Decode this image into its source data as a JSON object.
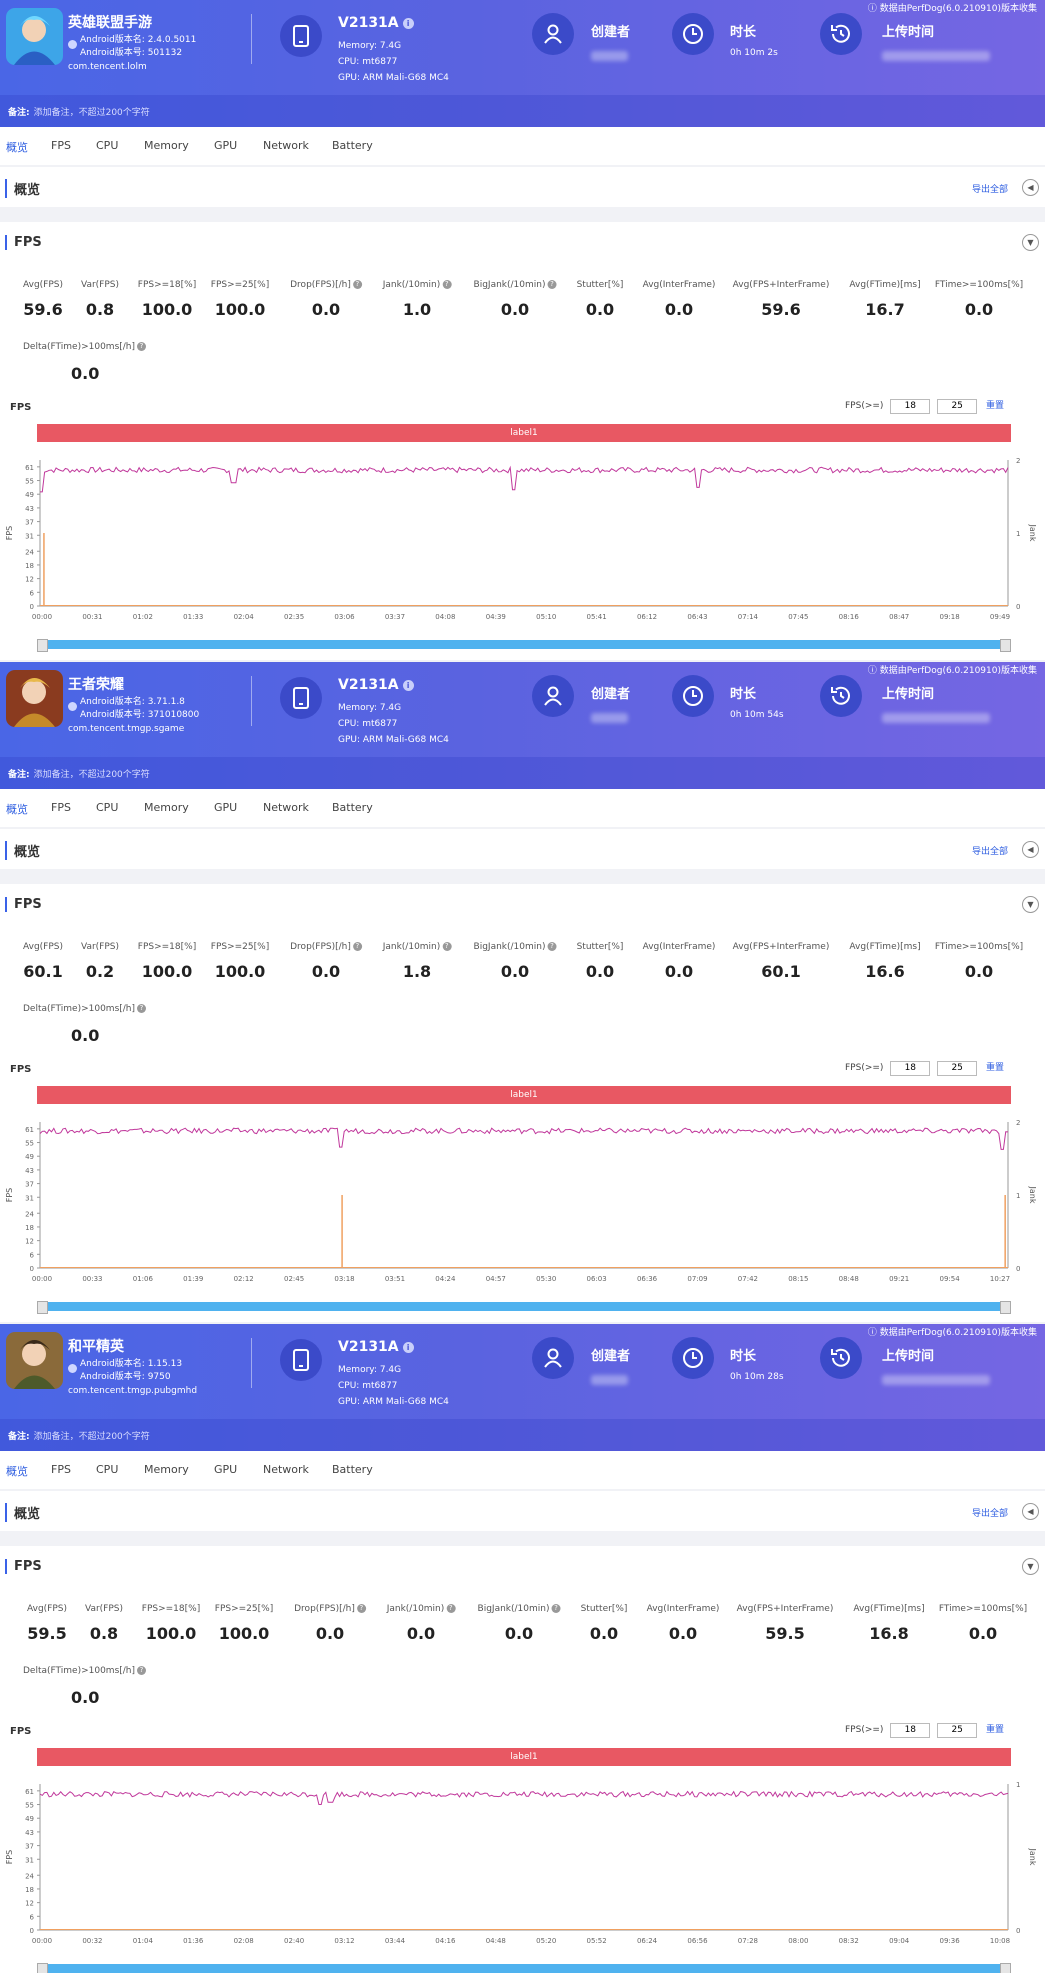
{
  "panels": [
    {
      "app": {
        "name": "英雄联盟手游",
        "version": "Android版本名: 2.4.0.5011",
        "build": "Android版本号: 501132",
        "package": "com.tencent.lolm",
        "icon": "game-icon"
      },
      "device": {
        "model": "V2131A",
        "memory": "Memory: 7.4G",
        "cpu": "CPU: mt6877",
        "gpu": "GPU: ARM Mali-G68 MC4"
      },
      "meta": {
        "creator_label": "创建者",
        "duration_label": "时长",
        "duration": "0h 10m 2s",
        "upload_label": "上传时间",
        "source": "ⓘ 数据由PerfDog(6.0.210910)版本收集"
      },
      "note": {
        "label": "备注:",
        "placeholder": "添加备注，不超过200个字符"
      },
      "tabs": [
        "概览",
        "FPS",
        "CPU",
        "Memory",
        "GPU",
        "Network",
        "Battery"
      ],
      "overview": {
        "title": "概览",
        "export": "导出全部"
      },
      "fps": {
        "title": "FPS",
        "metric_headers": [
          "Avg(FPS)",
          "Var(FPS)",
          "FPS>=18[%]",
          "FPS>=25[%]",
          "Drop(FPS)[/h]",
          "Jank(/10min)",
          "BigJank(/10min)",
          "Stutter[%]",
          "Avg(InterFrame)",
          "Avg(FPS+InterFrame)",
          "Avg(FTime)[ms]",
          "FTime>=100ms[%]"
        ],
        "metric_values": [
          "59.6",
          "0.8",
          "100.0",
          "100.0",
          "0.0",
          "1.0",
          "0.0",
          "0.0",
          "0.0",
          "59.6",
          "16.7",
          "0.0"
        ],
        "delta_header": "Delta(FTime)>100ms[/h]",
        "delta_value": "0.0",
        "chart_label": "FPS",
        "threshold_label": "FPS(>=)",
        "threshold_low": "18",
        "threshold_high": "25",
        "settings": "重置",
        "label_bar": "label1"
      },
      "chart_data": {
        "type": "line",
        "x_ticks": [
          "00:00",
          "00:31",
          "01:02",
          "01:33",
          "02:04",
          "02:35",
          "03:06",
          "03:37",
          "04:08",
          "04:39",
          "05:10",
          "05:41",
          "06:12",
          "06:43",
          "07:14",
          "07:45",
          "08:16",
          "08:47",
          "09:18",
          "09:49"
        ],
        "y_ticks": [
          0,
          6,
          12,
          18,
          24,
          31,
          37,
          43,
          49,
          55,
          61
        ],
        "y2_ticks": [
          0,
          1,
          2
        ],
        "ylabel": "FPS",
        "y2label": "Jank",
        "ylim": [
          0,
          64
        ],
        "series": [
          {
            "name": "FPS",
            "color": "#c0379b",
            "baseline": 59.6,
            "dips": [
              [
                0.0,
                50
              ],
              [
                0.2,
                54
              ],
              [
                0.49,
                51
              ],
              [
                0.68,
                52
              ]
            ]
          },
          {
            "name": "Jank",
            "color": "#f0a060",
            "spikes": [
              [
                0.002,
                1
              ]
            ]
          }
        ]
      }
    },
    {
      "app": {
        "name": "王者荣耀",
        "version": "Android版本名: 3.71.1.8",
        "build": "Android版本号: 371010800",
        "package": "com.tencent.tmgp.sgame",
        "icon": "game-icon"
      },
      "device": {
        "model": "V2131A",
        "memory": "Memory: 7.4G",
        "cpu": "CPU: mt6877",
        "gpu": "GPU: ARM Mali-G68 MC4"
      },
      "meta": {
        "creator_label": "创建者",
        "duration_label": "时长",
        "duration": "0h 10m 54s",
        "upload_label": "上传时间",
        "source": "ⓘ 数据由PerfDog(6.0.210910)版本收集"
      },
      "note": {
        "label": "备注:",
        "placeholder": "添加备注，不超过200个字符"
      },
      "tabs": [
        "概览",
        "FPS",
        "CPU",
        "Memory",
        "GPU",
        "Network",
        "Battery"
      ],
      "overview": {
        "title": "概览",
        "export": "导出全部"
      },
      "fps": {
        "title": "FPS",
        "metric_headers": [
          "Avg(FPS)",
          "Var(FPS)",
          "FPS>=18[%]",
          "FPS>=25[%]",
          "Drop(FPS)[/h]",
          "Jank(/10min)",
          "BigJank(/10min)",
          "Stutter[%]",
          "Avg(InterFrame)",
          "Avg(FPS+InterFrame)",
          "Avg(FTime)[ms]",
          "FTime>=100ms[%]"
        ],
        "metric_values": [
          "60.1",
          "0.2",
          "100.0",
          "100.0",
          "0.0",
          "1.8",
          "0.0",
          "0.0",
          "0.0",
          "60.1",
          "16.6",
          "0.0"
        ],
        "delta_header": "Delta(FTime)>100ms[/h]",
        "delta_value": "0.0",
        "chart_label": "FPS",
        "threshold_label": "FPS(>=)",
        "threshold_low": "18",
        "threshold_high": "25",
        "settings": "重置",
        "label_bar": "label1"
      },
      "chart_data": {
        "type": "line",
        "x_ticks": [
          "00:00",
          "00:33",
          "01:06",
          "01:39",
          "02:12",
          "02:45",
          "03:18",
          "03:51",
          "04:24",
          "04:57",
          "05:30",
          "06:03",
          "06:36",
          "07:09",
          "07:42",
          "08:15",
          "08:48",
          "09:21",
          "09:54",
          "10:27"
        ],
        "y_ticks": [
          0,
          6,
          12,
          18,
          24,
          31,
          37,
          43,
          49,
          55,
          61
        ],
        "y2_ticks": [
          0,
          1,
          2
        ],
        "ylabel": "FPS",
        "y2label": "Jank",
        "ylim": [
          0,
          64
        ],
        "series": [
          {
            "name": "FPS",
            "color": "#c0379b",
            "baseline": 60.1,
            "dips": [
              [
                0.31,
                53
              ],
              [
                0.995,
                52
              ]
            ]
          },
          {
            "name": "Jank",
            "color": "#f0a060",
            "spikes": [
              [
                0.31,
                1
              ],
              [
                0.995,
                1
              ]
            ]
          }
        ]
      }
    },
    {
      "app": {
        "name": "和平精英",
        "version": "Android版本名: 1.15.13",
        "build": "Android版本号: 9750",
        "package": "com.tencent.tmgp.pubgmhd",
        "icon": "game-icon"
      },
      "device": {
        "model": "V2131A",
        "memory": "Memory: 7.4G",
        "cpu": "CPU: mt6877",
        "gpu": "GPU: ARM Mali-G68 MC4"
      },
      "meta": {
        "creator_label": "创建者",
        "duration_label": "时长",
        "duration": "0h 10m 28s",
        "upload_label": "上传时间",
        "source": "ⓘ 数据由PerfDog(6.0.210910)版本收集"
      },
      "note": {
        "label": "备注:",
        "placeholder": "添加备注，不超过200个字符"
      },
      "tabs": [
        "概览",
        "FPS",
        "CPU",
        "Memory",
        "GPU",
        "Network",
        "Battery"
      ],
      "overview": {
        "title": "概览",
        "export": "导出全部"
      },
      "fps": {
        "title": "FPS",
        "metric_headers": [
          "Avg(FPS)",
          "Var(FPS)",
          "FPS>=18[%]",
          "FPS>=25[%]",
          "Drop(FPS)[/h]",
          "Jank(/10min)",
          "BigJank(/10min)",
          "Stutter[%]",
          "Avg(InterFrame)",
          "Avg(FPS+InterFrame)",
          "Avg(FTime)[ms]",
          "FTime>=100ms[%]"
        ],
        "metric_values": [
          "59.5",
          "0.8",
          "100.0",
          "100.0",
          "0.0",
          "0.0",
          "0.0",
          "0.0",
          "0.0",
          "59.5",
          "16.8",
          "0.0"
        ],
        "delta_header": "Delta(FTime)>100ms[/h]",
        "delta_value": "0.0",
        "chart_label": "FPS",
        "threshold_label": "FPS(>=)",
        "threshold_low": "18",
        "threshold_high": "25",
        "settings": "重置",
        "label_bar": "label1"
      },
      "chart_data": {
        "type": "line",
        "x_ticks": [
          "00:00",
          "00:32",
          "01:04",
          "01:36",
          "02:08",
          "02:40",
          "03:12",
          "03:44",
          "04:16",
          "04:48",
          "05:20",
          "05:52",
          "06:24",
          "06:56",
          "07:28",
          "08:00",
          "08:32",
          "09:04",
          "09:36",
          "10:08"
        ],
        "y_ticks": [
          0,
          6,
          12,
          18,
          24,
          31,
          37,
          43,
          49,
          55,
          61
        ],
        "y2_ticks": [
          0,
          1
        ],
        "ylabel": "FPS",
        "y2label": "Jank",
        "ylim": [
          0,
          64
        ],
        "series": [
          {
            "name": "FPS",
            "color": "#c0379b",
            "baseline": 59.5,
            "dips": [
              [
                0.29,
                55
              ],
              [
                0.3,
                56
              ]
            ]
          },
          {
            "name": "Jank",
            "color": "#f0a060",
            "spikes": []
          }
        ]
      }
    }
  ]
}
